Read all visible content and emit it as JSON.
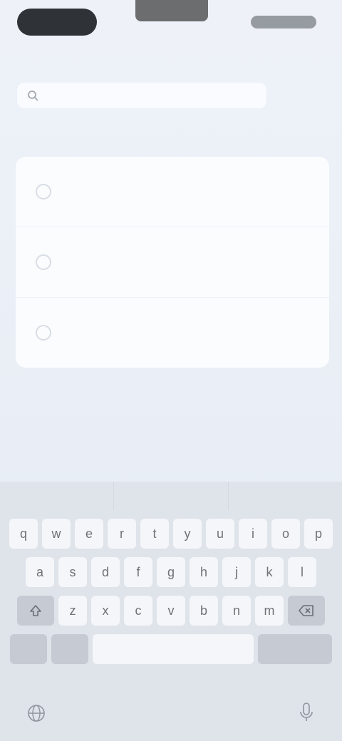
{
  "status_bar": {
    "time": "",
    "icons": [
      "cellular-icon",
      "wifi-icon",
      "battery-icon"
    ]
  },
  "nav": {
    "title": "",
    "action_label": ""
  },
  "search": {
    "placeholder": "",
    "cancel_label": ""
  },
  "section": {
    "header": ""
  },
  "list": {
    "items": [
      {
        "title": "",
        "subtitle": ""
      },
      {
        "title": "",
        "subtitle": ""
      },
      {
        "title": "",
        "subtitle": ""
      }
    ]
  },
  "keyboard": {
    "suggestions": [
      "",
      "",
      ""
    ],
    "row1": [
      "q",
      "w",
      "e",
      "r",
      "t",
      "y",
      "u",
      "i",
      "o",
      "p"
    ],
    "row2": [
      "a",
      "s",
      "d",
      "f",
      "g",
      "h",
      "j",
      "k",
      "l"
    ],
    "row3": [
      "z",
      "x",
      "c",
      "v",
      "b",
      "n",
      "m"
    ],
    "space_label": "",
    "action_label": "",
    "number_label": "",
    "emoji_label": ""
  },
  "colors": {
    "background": "#e9eef6",
    "card": "#fbfcfe",
    "accent": "#9aa6b8"
  }
}
